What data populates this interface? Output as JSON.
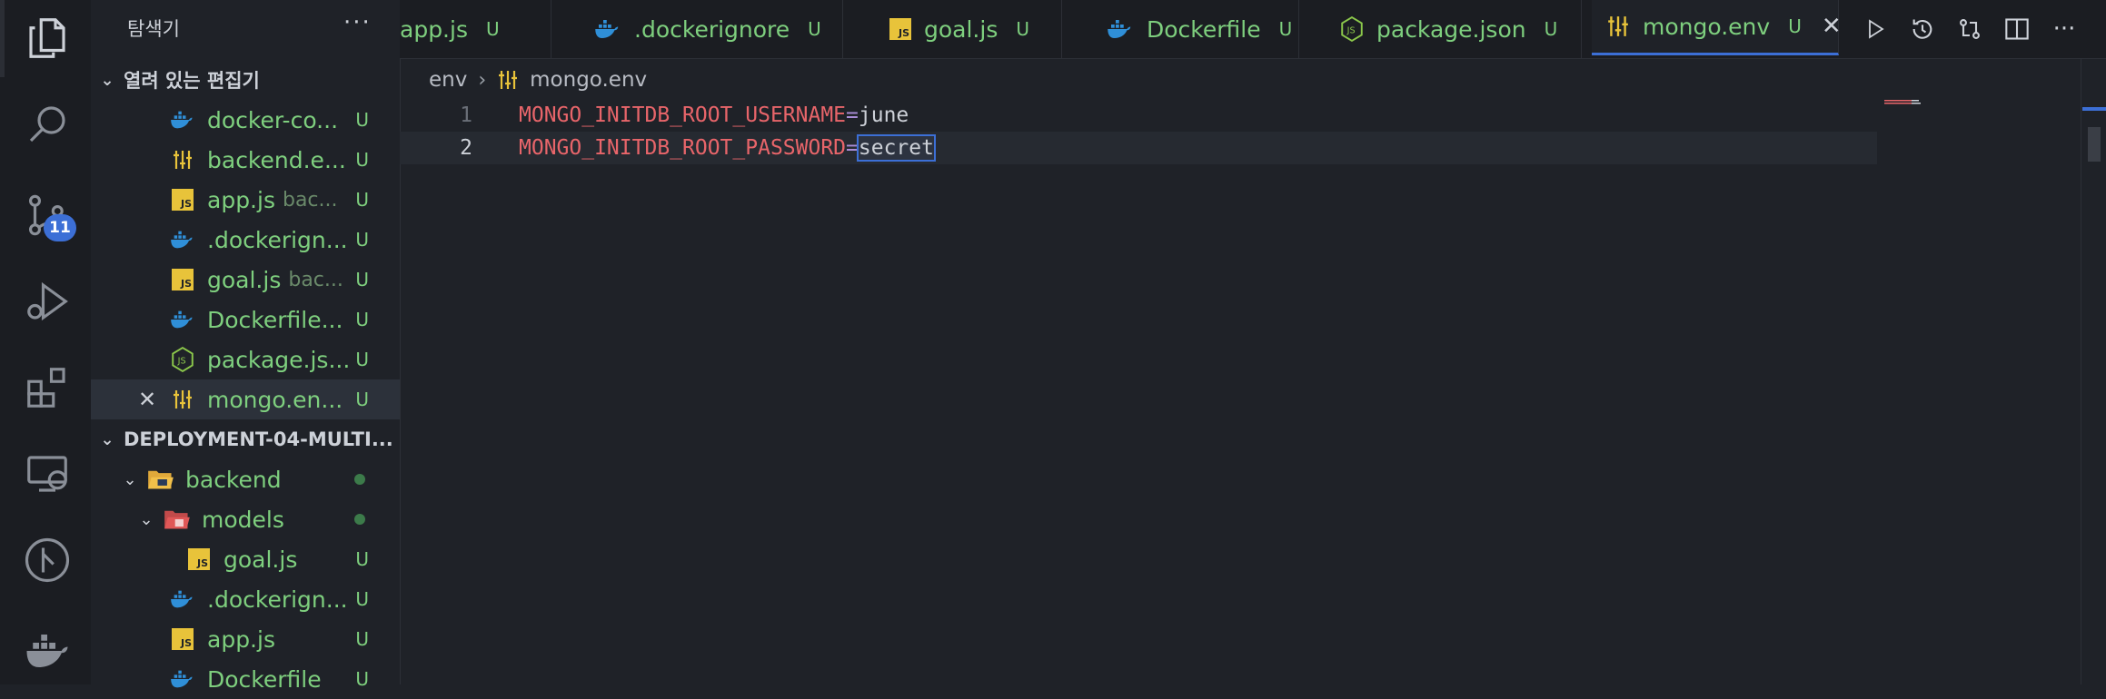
{
  "activity_bar": {
    "items": [
      "explorer-icon",
      "search-icon",
      "source-control-icon",
      "run-debug-icon",
      "extensions-icon",
      "remote-explorer-icon",
      "git-graph-icon",
      "docker-icon"
    ],
    "source_control_badge": "11"
  },
  "sidebar": {
    "title": "탐색기",
    "more": "···",
    "open_editors": {
      "label": "열려 있는 편집기",
      "items": [
        {
          "name": "docker-co...",
          "hint": "",
          "status": "U",
          "icon": "docker-icon"
        },
        {
          "name": "backend.e...",
          "hint": "",
          "status": "U",
          "icon": "env-settings-icon"
        },
        {
          "name": "app.js",
          "hint": "bac...",
          "status": "U",
          "icon": "js-icon"
        },
        {
          "name": ".dockerign...",
          "hint": "",
          "status": "U",
          "icon": "docker-icon"
        },
        {
          "name": "goal.js",
          "hint": "bac...",
          "status": "U",
          "icon": "js-icon"
        },
        {
          "name": "Dockerfile...",
          "hint": "",
          "status": "U",
          "icon": "docker-icon"
        },
        {
          "name": "package.js...",
          "hint": "",
          "status": "U",
          "icon": "nodejs-icon"
        },
        {
          "name": "mongo.en...",
          "hint": "",
          "status": "U",
          "icon": "env-settings-icon"
        }
      ]
    },
    "project": {
      "label": "DEPLOYMENT-04-MULTI...",
      "items": [
        {
          "name": "backend",
          "status": "dot"
        },
        {
          "name": "models",
          "status": "dot"
        },
        {
          "name": "goal.js",
          "status": "U"
        },
        {
          "name": ".dockerign...",
          "status": "U"
        },
        {
          "name": "app.js",
          "status": "U"
        },
        {
          "name": "Dockerfile",
          "status": "U"
        }
      ]
    }
  },
  "tabs": [
    {
      "label": "app.js",
      "status": "U"
    },
    {
      "label": ".dockerignore",
      "status": "U"
    },
    {
      "label": "goal.js",
      "status": "U"
    },
    {
      "label": "Dockerfile",
      "status": "U"
    },
    {
      "label": "package.json",
      "status": "U"
    },
    {
      "label": "mongo.env",
      "status": "U",
      "close": "✕"
    }
  ],
  "tab_actions": [
    "run-icon",
    "timeline-icon",
    "compare-icon",
    "split-editor-icon",
    "more-actions-icon"
  ],
  "tab_more": "···",
  "breadcrumb": {
    "folder": "env",
    "sep": "›",
    "file": "mongo.env"
  },
  "editor": {
    "lines": [
      {
        "number": "1",
        "key": "MONGO_INITDB_ROOT_USERNAME",
        "eq": "=",
        "value": "june"
      },
      {
        "number": "2",
        "key": "MONGO_INITDB_ROOT_PASSWORD",
        "eq": "=",
        "value": "secret"
      }
    ],
    "current_line": 2
  },
  "colors": {
    "accent": "#3c6fd6",
    "untracked": "#7ecf7e",
    "env_key": "#e8656a",
    "js_badge": "#e8c33a",
    "docker": "#2f8fd8"
  }
}
